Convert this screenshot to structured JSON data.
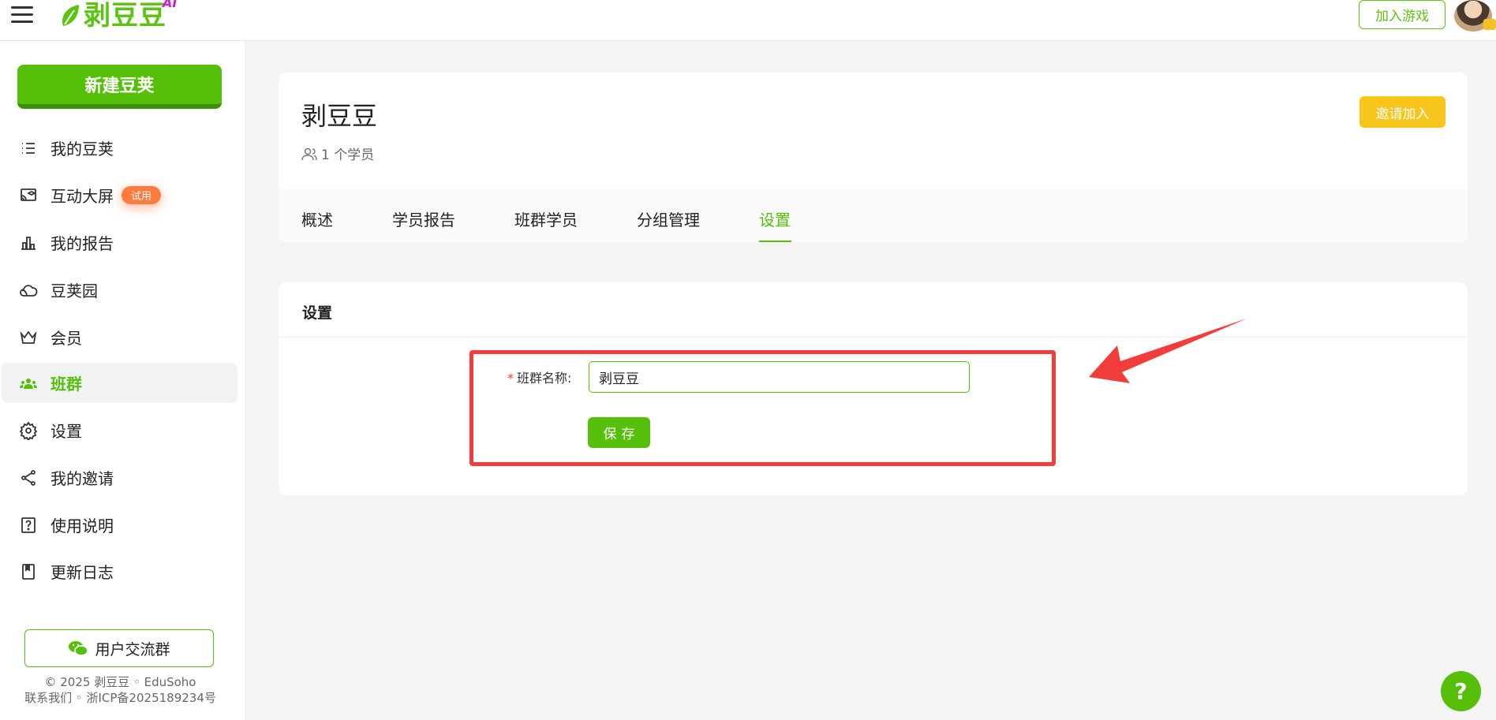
{
  "header": {
    "logo_text": "剥豆豆",
    "logo_badge": "AI",
    "join_game_label": "加入游戏",
    "brand_color": "#5cc411"
  },
  "sidebar": {
    "new_button_label": "新建豆荚",
    "items": [
      {
        "label": "我的豆荚",
        "icon": "list-icon"
      },
      {
        "label": "互动大屏",
        "icon": "cast-screen-icon",
        "badge": "试用"
      },
      {
        "label": "我的报告",
        "icon": "bar-chart-icon"
      },
      {
        "label": "豆荚园",
        "icon": "cloud-icon"
      },
      {
        "label": "会员",
        "icon": "crown-icon"
      },
      {
        "label": "班群",
        "icon": "group-icon",
        "active": true
      },
      {
        "label": "设置",
        "icon": "gear-icon"
      },
      {
        "label": "我的邀请",
        "icon": "share-icon"
      },
      {
        "label": "使用说明",
        "icon": "help-square-icon"
      },
      {
        "label": "更新日志",
        "icon": "bookmark-icon"
      }
    ],
    "group_button_label": "用户交流群",
    "footer_line1": "© 2025 剥豆豆 ◦ EduSoho",
    "footer_line2": "联系我们 ◦ 浙ICP备2025189234号"
  },
  "class": {
    "title": "剥豆豆",
    "member_count": "1 个学员",
    "invite_label": "邀请加入",
    "tabs": [
      "概述",
      "学员报告",
      "班群学员",
      "分组管理",
      "设置"
    ],
    "active_tab": "设置"
  },
  "settings": {
    "heading": "设置",
    "field_label": "班群名称:",
    "required_mark": "*",
    "name_value": "剥豆豆",
    "save_label": "保存"
  },
  "help_label": "?",
  "colors": {
    "accent": "#56bf0a",
    "warning": "#f8c51c",
    "highlight": "#f23d3d"
  }
}
